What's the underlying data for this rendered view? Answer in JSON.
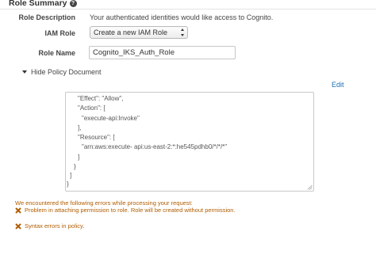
{
  "section": {
    "title": "Role Summary",
    "help_glyph": "?"
  },
  "role_description": {
    "label": "Role Description",
    "value": "Your authenticated identities would like access to Cognito."
  },
  "iam_role": {
    "label": "IAM Role",
    "selected": "Create a new IAM Role"
  },
  "role_name": {
    "label": "Role Name",
    "value": "Cognito_IKS_Auth_Role"
  },
  "policy_toggle": {
    "label": "Hide Policy Document",
    "icon": "caret-down-icon"
  },
  "edit_label": "Edit",
  "policy_lines": [
    "\"Effect\": \"Allow\",",
    "\"Action\": [",
    "\"execute-api:Invoke\"",
    "],",
    "\"Resource\": [",
    "\"arn:aws:execute- api:us-east-2:*:he545pdhb0/*/*/*\"",
    "]",
    "}",
    "]",
    "}"
  ],
  "errors": {
    "intro": "We encountered the following errors while processing your request:",
    "items": [
      {
        "icon": "error-x-icon",
        "text": "Problem in attaching permission to role. Role will be created without permission."
      },
      {
        "icon": "error-x-icon",
        "text": "Syntax errors in policy."
      }
    ],
    "color": "#b15c00"
  },
  "colors": {
    "link": "#1a6fb5"
  }
}
